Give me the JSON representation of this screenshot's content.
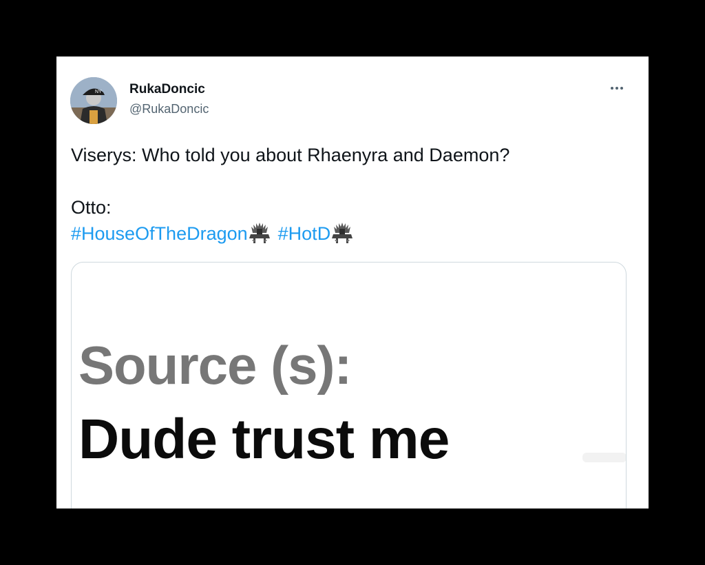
{
  "tweet": {
    "display_name": "RukaDoncic",
    "handle": "@RukaDoncic",
    "text_line1": "Viserys: Who told you about Rhaenyra and Daemon?",
    "text_line2": "Otto:",
    "hashtags": [
      "#HouseOfTheDragon",
      "#HotD"
    ]
  },
  "media": {
    "line1": "Source (s):",
    "line2": "Dude trust me"
  },
  "icons": {
    "more": "more-options-icon",
    "hashtag_emoji": "iron-throne-icon"
  },
  "colors": {
    "background": "#000000",
    "card": "#ffffff",
    "hashtag": "#1d9bf0",
    "name": "#0f1419",
    "handle": "#536471"
  }
}
